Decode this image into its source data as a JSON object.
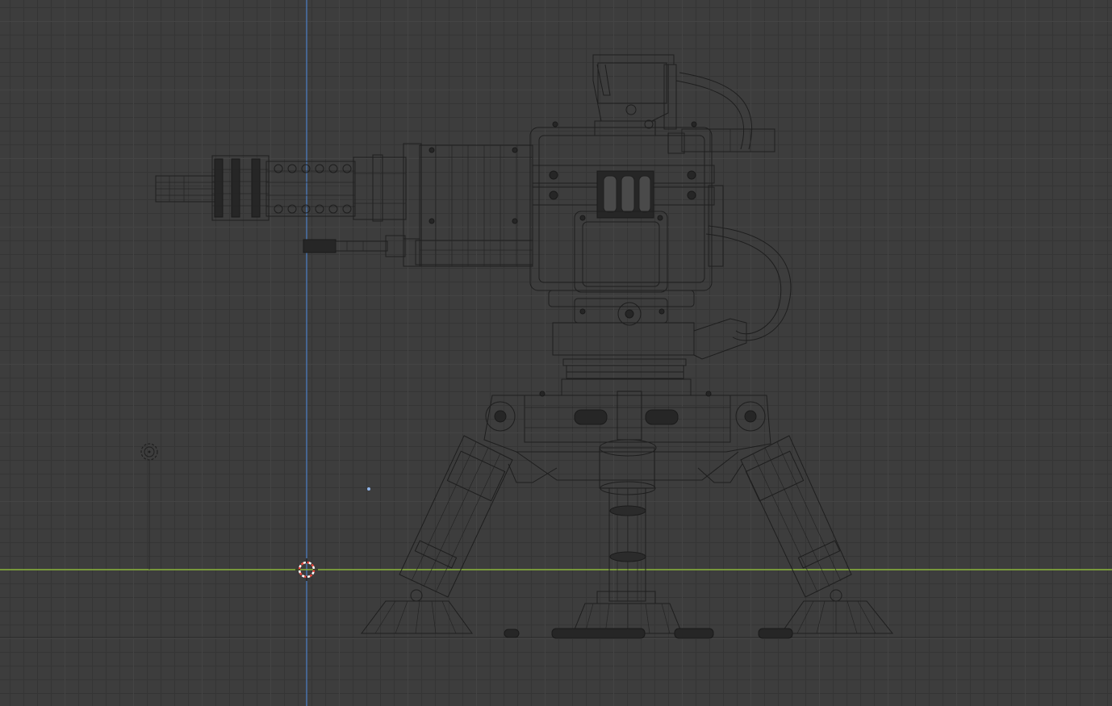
{
  "viewport": {
    "background": "#3d3d3d",
    "grid_major_color": "#444444",
    "grid_minor_color": "#353535",
    "x_axis_color": "#8ab33a",
    "z_axis_color": "#4c80c8",
    "view": "front-orthographic",
    "shading": "wireframe"
  },
  "scene": {
    "model": "sentry-turret",
    "objects": [
      "3d-cursor-icon",
      "light-icon",
      "origin-point"
    ]
  }
}
